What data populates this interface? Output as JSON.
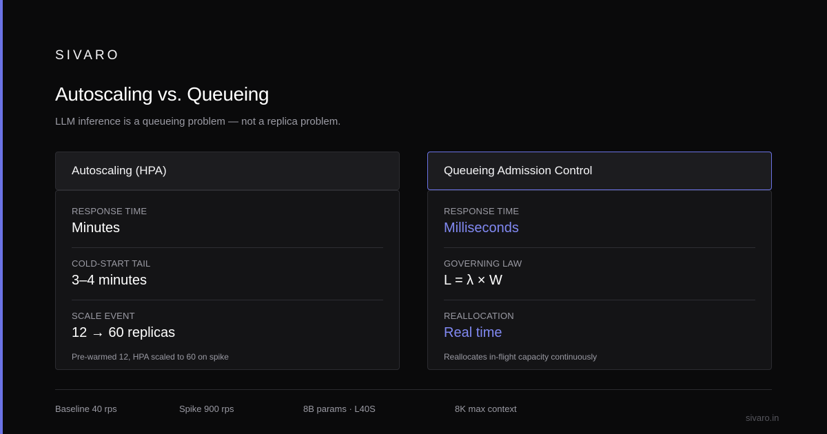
{
  "brand": "SIVARO",
  "title": "Autoscaling vs. Queueing",
  "subtitle": "LLM inference is a queueing problem — not a replica problem.",
  "colors": {
    "background": "#0a0a0b",
    "accent": "#6b73e6",
    "accent_text": "#8189f2"
  },
  "left": {
    "header": "Autoscaling (HPA)",
    "metrics": [
      {
        "label": "RESPONSE TIME",
        "value": "Minutes"
      },
      {
        "label": "COLD-START TAIL",
        "value": "3–4 minutes"
      },
      {
        "label": "SCALE EVENT",
        "value": "12 → 60 replicas"
      }
    ],
    "note": "Pre-warmed 12, HPA scaled to 60 on spike"
  },
  "right": {
    "header": "Queueing Admission Control",
    "metrics": [
      {
        "label": "RESPONSE TIME",
        "value": "Milliseconds"
      },
      {
        "label": "GOVERNING LAW",
        "value": "L = λ × W"
      },
      {
        "label": "REALLOCATION",
        "value": "Real time"
      }
    ],
    "note": "Reallocates in-flight capacity continuously"
  },
  "footer": {
    "items": [
      "Baseline 40 rps",
      "Spike 900 rps",
      "8B params · L40S",
      "8K max context"
    ],
    "site": "sivaro.in"
  }
}
